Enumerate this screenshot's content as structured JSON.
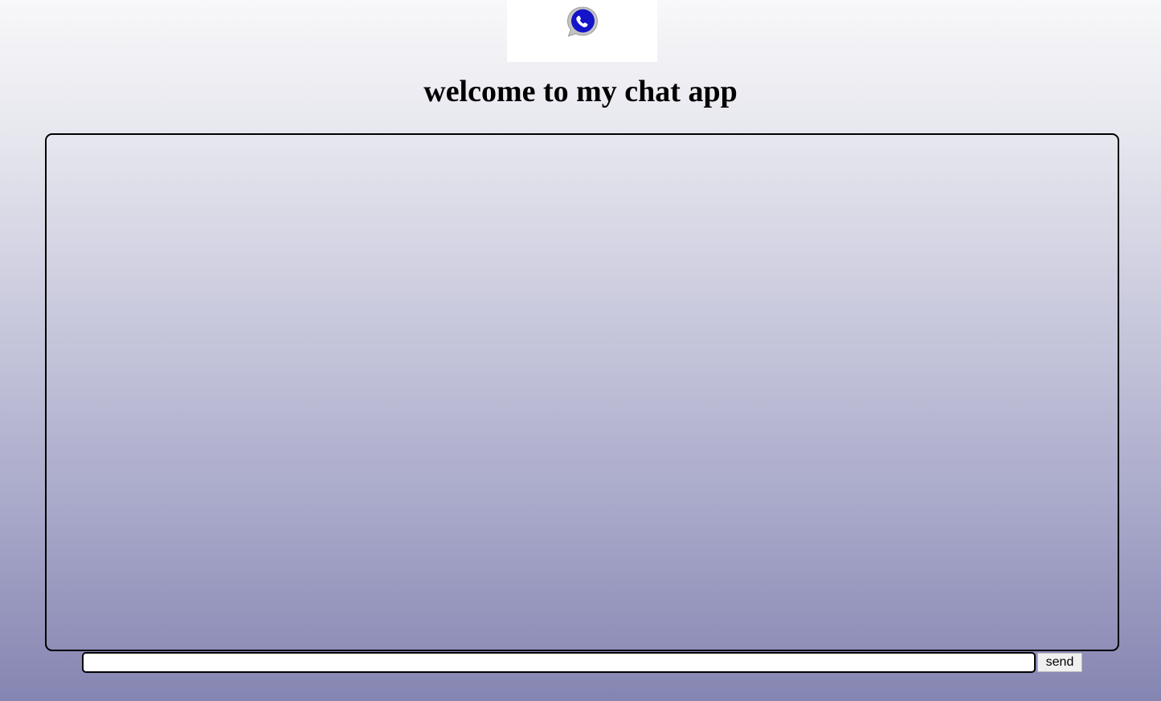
{
  "header": {
    "logo_icon": "whatsapp-style-chat-icon",
    "title": "welcome to my chat app"
  },
  "composer": {
    "input_value": "",
    "input_placeholder": "",
    "send_label": "send"
  },
  "colors": {
    "logo_blue": "#1414c8",
    "logo_bubble_outline": "#bdbdbd",
    "background_top": "#f8f8fa",
    "background_bottom": "#8585b2"
  }
}
